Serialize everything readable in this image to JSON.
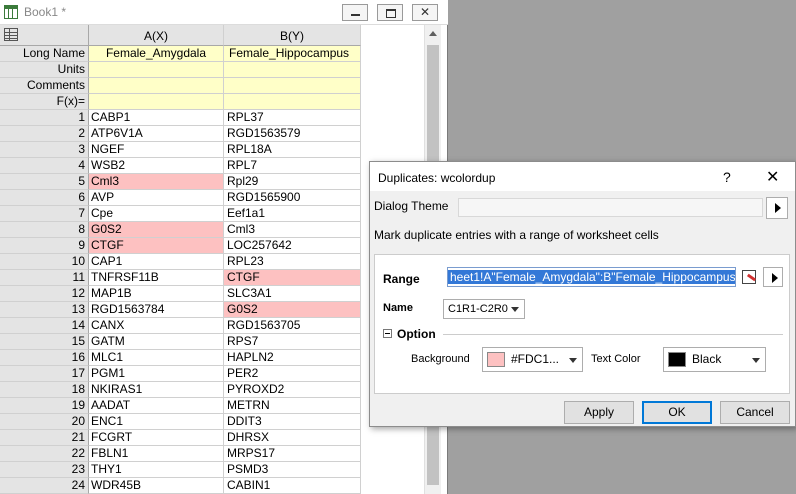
{
  "book": {
    "title": "Book1 *",
    "close_glyph": "✕",
    "columns": {
      "a": "A(X)",
      "b": "B(Y)"
    },
    "meta_rows": [
      {
        "label": "Long Name",
        "a": "Female_Amygdala",
        "b": "Female_Hippocampus"
      },
      {
        "label": "Units",
        "a": "",
        "b": ""
      },
      {
        "label": "Comments",
        "a": "",
        "b": ""
      },
      {
        "label": "F(x)=",
        "a": "",
        "b": ""
      }
    ],
    "rows": [
      {
        "n": "1",
        "a": "CABP1",
        "b": "RPL37"
      },
      {
        "n": "2",
        "a": "ATP6V1A",
        "b": "RGD1563579"
      },
      {
        "n": "3",
        "a": "NGEF",
        "b": "RPL18A"
      },
      {
        "n": "4",
        "a": "WSB2",
        "b": "RPL7"
      },
      {
        "n": "5",
        "a": "Cml3",
        "b": "Rpl29"
      },
      {
        "n": "6",
        "a": "AVP",
        "b": "RGD1565900"
      },
      {
        "n": "7",
        "a": "Cpe",
        "b": "Eef1a1"
      },
      {
        "n": "8",
        "a": "G0S2",
        "b": "Cml3"
      },
      {
        "n": "9",
        "a": "CTGF",
        "b": "LOC257642"
      },
      {
        "n": "10",
        "a": "CAP1",
        "b": "RPL23"
      },
      {
        "n": "11",
        "a": "TNFRSF11B",
        "b": "CTGF"
      },
      {
        "n": "12",
        "a": "MAP1B",
        "b": "SLC3A1"
      },
      {
        "n": "13",
        "a": "RGD1563784",
        "b": "G0S2"
      },
      {
        "n": "14",
        "a": "CANX",
        "b": "RGD1563705"
      },
      {
        "n": "15",
        "a": "GATM",
        "b": "RPS7"
      },
      {
        "n": "16",
        "a": "MLC1",
        "b": "HAPLN2"
      },
      {
        "n": "17",
        "a": "PGM1",
        "b": "PER2"
      },
      {
        "n": "18",
        "a": "NKIRAS1",
        "b": "PYROXD2"
      },
      {
        "n": "19",
        "a": "AADAT",
        "b": "METRN"
      },
      {
        "n": "20",
        "a": "ENC1",
        "b": "DDIT3"
      },
      {
        "n": "21",
        "a": "FCGRT",
        "b": "DHRSX"
      },
      {
        "n": "22",
        "a": "FBLN1",
        "b": "MRPS17"
      },
      {
        "n": "23",
        "a": "THY1",
        "b": "PSMD3"
      },
      {
        "n": "24",
        "a": "WDR45B",
        "b": "CABIN1"
      }
    ],
    "duplicates_a": [
      "5",
      "8",
      "9"
    ],
    "duplicates_b": [
      "11",
      "13"
    ],
    "duplicate_color": "#FDC1C1",
    "meta_color": "#FFFFC8"
  },
  "dialog": {
    "title": "Duplicates: wcolordup",
    "help": "?",
    "close": "✕",
    "theme_label": "Dialog Theme",
    "description": "Mark duplicate entries with a range of worksheet cells",
    "range_label": "Range",
    "range_value": "heet1!A\"Female_Amygdala\":B\"Female_Hippocampus\"",
    "name_label": "Name",
    "name_value": "C1R1-C2R0",
    "option_label": "Option",
    "background_label": "Background",
    "background_value": "#FDC1...",
    "text_color_label": "Text Color",
    "text_color_value": "Black",
    "apply": "Apply",
    "ok": "OK",
    "cancel": "Cancel"
  }
}
